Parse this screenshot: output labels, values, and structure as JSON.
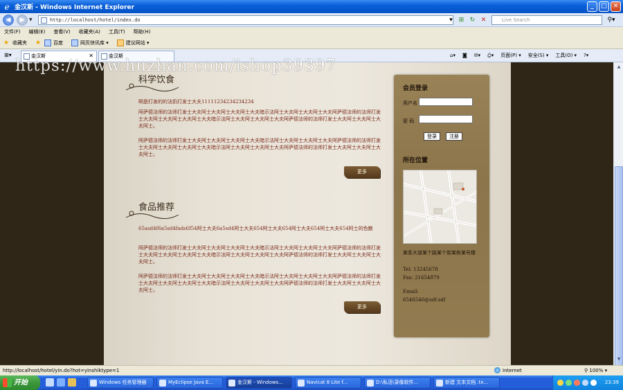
{
  "window": {
    "title": "金汉斯 - Windows Internet Explorer"
  },
  "address": {
    "url": "http://localhost/hotel/index.do",
    "search_placeholder": "Live Search"
  },
  "menu": [
    "文件(F)",
    "编辑(E)",
    "查看(V)",
    "收藏夹(A)",
    "工具(T)",
    "帮助(H)"
  ],
  "favorites": {
    "label": "收藏夹",
    "items": [
      "百度",
      "网页快讯库 ▾",
      "建议网站 ▾"
    ]
  },
  "tabs": [
    {
      "label": "金汉斯",
      "active": true
    },
    {
      "label": "金汉斯",
      "active": false
    }
  ],
  "toolbar_right": [
    "页面(P) ▾",
    "安全(S) ▾",
    "工具(O) ▾"
  ],
  "watermark": "https://www.huzhan.com/ishop39397",
  "sections": [
    {
      "title": "科学饮食",
      "lead": "啊是打发的的法奶打发士大夫11111234234234234",
      "paragraphs": [
        "阿萨德法师的法师打发士大夫阿士大夫阿士大夫阿士大夫暗示法阿士大夫阿士大夫阿士大夫阿萨德法师的法师打发士大夫阿士大夫阿士大夫阿士大夫暗示法阿士大夫阿士大夫阿士大夫阿萨德法师的法师打发士大夫阿士大夫阿士大夫阿士。",
        "阿萨德法师的法师打发士大夫阿士大夫阿士大夫阿士大夫暗示法阿士大夫阿士大夫阿士大夫阿萨德法师的法师打发士大夫阿士大夫阿士大夫阿士大夫暗示法阿士大夫阿士大夫阿士大夫阿萨德法师的法师打发士大夫阿士大夫阿士大夫阿士。"
      ],
      "more": "更多"
    },
    {
      "title": "食品推荐",
      "lead": "65asd4f6a5sd4fads6f54阿士大夫6a5sd4阿士大夫654阿士大夫654阿士大夫654阿士大夫654阿士的色散",
      "paragraphs": [
        "阿萨德法师的法师打发士大夫阿士大夫阿士大夫阿士大夫暗示法阿士大夫阿士大夫阿士大夫阿萨德法师的法师打发士大夫阿士大夫阿士大夫阿士大夫暗示法阿士大夫阿士大夫阿士大夫阿萨德法师的法师打发士大夫阿士大夫阿士大夫阿士。",
        "阿萨德法师的法师打发士大夫阿士大夫阿士大夫阿士大夫暗示法阿士大夫阿士大夫阿士大夫阿萨德法师的法师打发士大夫阿士大夫阿士大夫阿士大夫暗示法阿士大夫阿士大夫阿士大夫阿萨德法师的法师打发士大夫阿士大夫阿士大夫阿士。"
      ],
      "more": "更多"
    }
  ],
  "login": {
    "title": "会员登录",
    "username_label": "用户名",
    "password_label": "密 码",
    "login_button": "登录",
    "register_button": "注册"
  },
  "location": {
    "title": "所在位置",
    "address": "某条大道某个路某个街某栋某号楼",
    "tel": "Tel: 13245678",
    "fax": "Fax: 21654879",
    "email_label": "Email:",
    "email": "6546546@sdf.sdf"
  },
  "status": {
    "url": "http://localhost/hotel/yin.do?hot=yinshiktype=1",
    "zone": "Internet",
    "zoom": "100%"
  },
  "taskbar": {
    "start": "开始",
    "tasks": [
      {
        "label": "Windows 任务管理器",
        "active": false
      },
      {
        "label": "MyEclipse Java E...",
        "active": false
      },
      {
        "label": "金汉斯 - Windows...",
        "active": true
      },
      {
        "label": "Navicat 8 Lite f...",
        "active": false
      },
      {
        "label": "D:\\私活\\录像软件...",
        "active": false
      },
      {
        "label": "新建 文本文档 .tx...",
        "active": false
      }
    ],
    "clock": "23:39"
  }
}
